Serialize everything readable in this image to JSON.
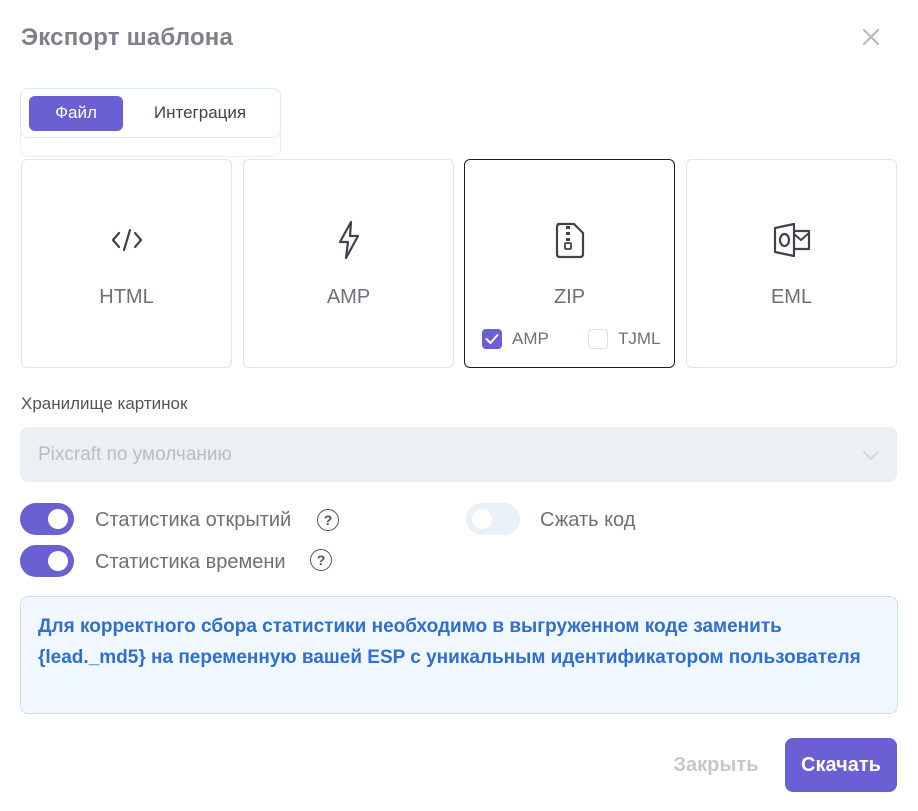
{
  "dialog": {
    "title": "Экспорт шаблона",
    "close_icon": "close-icon"
  },
  "tabs": [
    {
      "label": "Файл",
      "active": true
    },
    {
      "label": "Интеграция",
      "active": false
    }
  ],
  "formats": [
    {
      "label": "HTML",
      "icon": "code-icon",
      "selected": false
    },
    {
      "label": "AMP",
      "icon": "lightning-icon",
      "selected": false
    },
    {
      "label": "ZIP",
      "icon": "zip-file-icon",
      "selected": true,
      "options": [
        {
          "label": "AMP",
          "checked": true
        },
        {
          "label": "TJML",
          "checked": false
        }
      ]
    },
    {
      "label": "EML",
      "icon": "outlook-icon",
      "selected": false
    }
  ],
  "storage": {
    "label": "Хранилище картинок",
    "value": "Pixcraft по умолчанию"
  },
  "toggles": {
    "open_stats": {
      "label": "Статистика открытий",
      "on": true
    },
    "time_stats": {
      "label": "Статистика времени",
      "on": true
    },
    "minify": {
      "label": "Сжать код",
      "on": false
    }
  },
  "info": {
    "text": "Для корректного сбора статистики необходимо в выгруженном коде заменить {lead._md5} на переменную вашей ESP с уникальным идентификатором пользователя"
  },
  "footer": {
    "close_label": "Закрыть",
    "download_label": "Скачать"
  },
  "colors": {
    "accent": "#6a5fd3",
    "info_text": "#2d6fd2",
    "info_bg": "#f0f7fe"
  }
}
